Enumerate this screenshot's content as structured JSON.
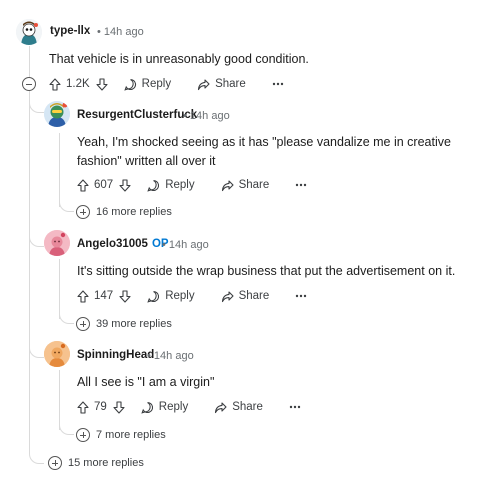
{
  "comments": [
    {
      "user": "type-llx",
      "time": "14h ago",
      "body": "That vehicle is in unreasonably good condition.",
      "votes": "1.2K",
      "reply_label": "Reply",
      "share_label": "Share"
    },
    {
      "user": "ResurgentClusterfuck",
      "time": "14h ago",
      "body": "Yeah, I'm shocked seeing as it has \"please vandalize me in creative fashion\" written all over it",
      "votes": "607",
      "reply_label": "Reply",
      "share_label": "Share",
      "more_replies": "16 more replies"
    },
    {
      "user": "Angelo31005",
      "op_badge": "OP",
      "time": "14h ago",
      "body": "It's sitting outside the wrap business that put the advertisement on it.",
      "votes": "147",
      "reply_label": "Reply",
      "share_label": "Share",
      "more_replies": "39 more replies"
    },
    {
      "user": "SpinningHead",
      "time": "14h ago",
      "body": "All I see is \"I am a virgin\"",
      "votes": "79",
      "reply_label": "Reply",
      "share_label": "Share",
      "more_replies": "7 more replies"
    }
  ],
  "thread_more_replies": "15 more replies",
  "separator": "•",
  "colors": {
    "op": "#0079d3",
    "thread_line": "#dadada",
    "meta": "#6a6f73"
  }
}
